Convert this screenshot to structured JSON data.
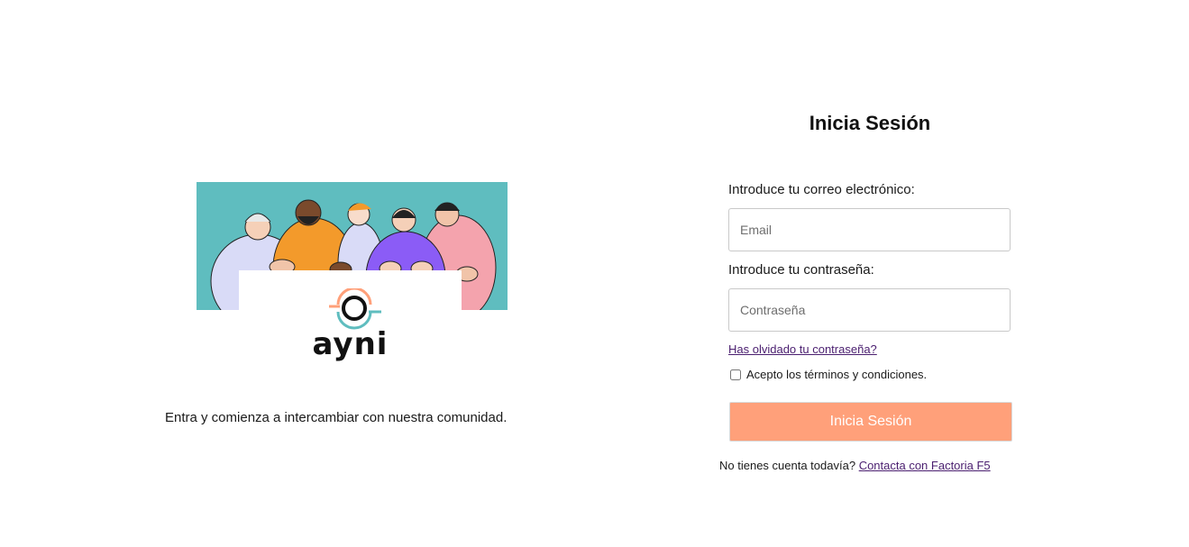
{
  "brand": {
    "name": "ayni",
    "tagline": "Entra y comienza a intercambiar con nuestra comunidad.",
    "colors": {
      "teal": "#5fbdbf",
      "orange": "#f39a2b",
      "purple": "#8b5cf6",
      "pink": "#f4a3ad",
      "accent": "#ffa07a"
    }
  },
  "login": {
    "title": "Inicia Sesión",
    "email_label": "Introduce tu correo electrónico:",
    "email_placeholder": "Email",
    "password_label": "Introduce tu contraseña:",
    "password_placeholder": "Contraseña",
    "forgot_link": "Has olvidado tu contraseña?",
    "terms_label": "Acepto los términos y condiciones.",
    "terms_checked": false,
    "submit_label": "Inicia Sesión",
    "signup_prompt": "No tienes cuenta todavía?",
    "signup_link": "Contacta con Factoria F5"
  }
}
